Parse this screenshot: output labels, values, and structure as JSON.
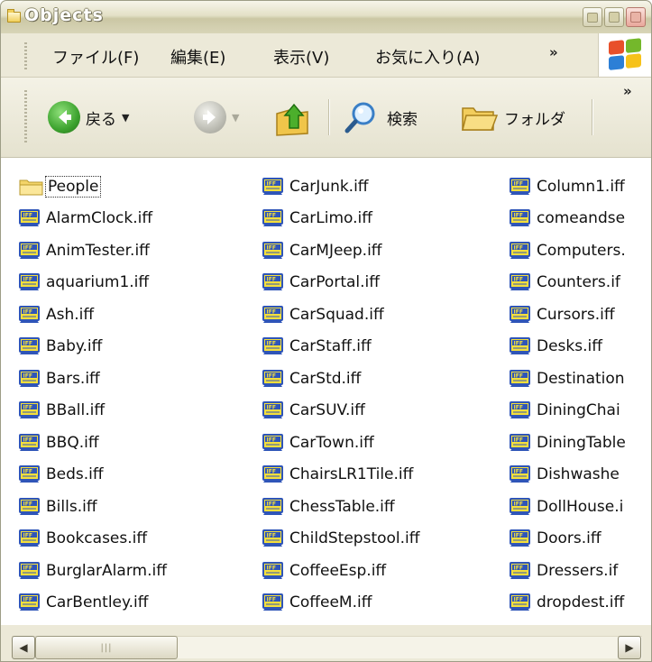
{
  "window": {
    "title": "Objects"
  },
  "menu": {
    "items": [
      "ファイル(F)",
      "編集(E)",
      "表示(V)",
      "お気に入り(A)"
    ],
    "overflow": "»"
  },
  "toolbar": {
    "back_label": "戻る",
    "search_label": "検索",
    "folders_label": "フォルダ",
    "overflow": "»"
  },
  "files": {
    "columns": [
      [
        {
          "name": "People",
          "type": "folder",
          "focused": true
        },
        {
          "name": "AlarmClock.iff",
          "type": "iff"
        },
        {
          "name": "AnimTester.iff",
          "type": "iff"
        },
        {
          "name": "aquarium1.iff",
          "type": "iff"
        },
        {
          "name": "Ash.iff",
          "type": "iff"
        },
        {
          "name": "Baby.iff",
          "type": "iff"
        },
        {
          "name": "Bars.iff",
          "type": "iff"
        },
        {
          "name": "BBall.iff",
          "type": "iff"
        },
        {
          "name": "BBQ.iff",
          "type": "iff"
        },
        {
          "name": "Beds.iff",
          "type": "iff"
        },
        {
          "name": "Bills.iff",
          "type": "iff"
        },
        {
          "name": "Bookcases.iff",
          "type": "iff"
        },
        {
          "name": "BurglarAlarm.iff",
          "type": "iff"
        },
        {
          "name": "CarBentley.iff",
          "type": "iff"
        }
      ],
      [
        {
          "name": "CarJunk.iff",
          "type": "iff"
        },
        {
          "name": "CarLimo.iff",
          "type": "iff"
        },
        {
          "name": "CarMJeep.iff",
          "type": "iff"
        },
        {
          "name": "CarPortal.iff",
          "type": "iff"
        },
        {
          "name": "CarSquad.iff",
          "type": "iff"
        },
        {
          "name": "CarStaff.iff",
          "type": "iff"
        },
        {
          "name": "CarStd.iff",
          "type": "iff"
        },
        {
          "name": "CarSUV.iff",
          "type": "iff"
        },
        {
          "name": "CarTown.iff",
          "type": "iff"
        },
        {
          "name": "ChairsLR1Tile.iff",
          "type": "iff"
        },
        {
          "name": "ChessTable.iff",
          "type": "iff"
        },
        {
          "name": "ChildStepstool.iff",
          "type": "iff"
        },
        {
          "name": "CoffeeEsp.iff",
          "type": "iff"
        },
        {
          "name": "CoffeeM.iff",
          "type": "iff"
        }
      ],
      [
        {
          "name": "Column1.iff",
          "type": "iff"
        },
        {
          "name": "comeandse",
          "type": "iff"
        },
        {
          "name": "Computers.",
          "type": "iff"
        },
        {
          "name": "Counters.if",
          "type": "iff"
        },
        {
          "name": "Cursors.iff",
          "type": "iff"
        },
        {
          "name": "Desks.iff",
          "type": "iff"
        },
        {
          "name": "Destination",
          "type": "iff"
        },
        {
          "name": "DiningChai",
          "type": "iff"
        },
        {
          "name": "DiningTable",
          "type": "iff"
        },
        {
          "name": "Dishwashe",
          "type": "iff"
        },
        {
          "name": "DollHouse.i",
          "type": "iff"
        },
        {
          "name": "Doors.iff",
          "type": "iff"
        },
        {
          "name": "Dressers.if",
          "type": "iff"
        },
        {
          "name": "dropdest.iff",
          "type": "iff"
        }
      ]
    ]
  },
  "colors": {
    "back_green": "#3da32f",
    "forward_gray": "#bdbdb4",
    "iff_icon_blue": "#2f55b8",
    "iff_icon_yellow": "#f4df3c"
  }
}
